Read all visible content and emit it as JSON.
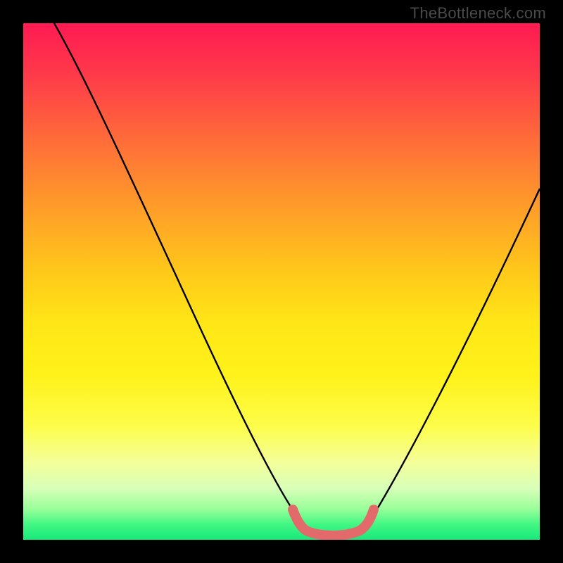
{
  "watermark": {
    "text": "TheBottleneck.com"
  },
  "chart_data": {
    "type": "line",
    "title": "",
    "xlabel": "",
    "ylabel": "",
    "xlim": [
      0,
      100
    ],
    "ylim": [
      0,
      100
    ],
    "grid": false,
    "legend": false,
    "series": [
      {
        "name": "bottleneck-curve",
        "x": [
          6,
          10,
          15,
          20,
          25,
          30,
          35,
          40,
          45,
          50,
          53,
          55,
          57,
          60,
          63,
          65,
          68,
          72,
          78,
          85,
          92,
          99
        ],
        "y": [
          100,
          92,
          82,
          72,
          62,
          52,
          42,
          32,
          22,
          12,
          6,
          3,
          1.5,
          1,
          1.5,
          3,
          7,
          15,
          28,
          42,
          55,
          68
        ]
      },
      {
        "name": "minimum-marker",
        "x": [
          53,
          55,
          57,
          59,
          61,
          63,
          65
        ],
        "y": [
          5,
          2.2,
          1.2,
          1,
          1.2,
          2.2,
          5
        ]
      }
    ],
    "gradient_stops": [
      {
        "pos": 0,
        "color": "#ff1a52"
      },
      {
        "pos": 10,
        "color": "#ff3a4a"
      },
      {
        "pos": 22,
        "color": "#ff6a3a"
      },
      {
        "pos": 35,
        "color": "#ff9a2a"
      },
      {
        "pos": 48,
        "color": "#ffc81a"
      },
      {
        "pos": 58,
        "color": "#ffe617"
      },
      {
        "pos": 68,
        "color": "#fff21a"
      },
      {
        "pos": 78,
        "color": "#fdfd4a"
      },
      {
        "pos": 85,
        "color": "#f4ff9a"
      },
      {
        "pos": 90,
        "color": "#d8ffb8"
      },
      {
        "pos": 94,
        "color": "#9aff9a"
      },
      {
        "pos": 97,
        "color": "#42f784"
      },
      {
        "pos": 100,
        "color": "#18e97a"
      }
    ],
    "colors": {
      "curve": "#000000",
      "marker": "#e26a6a",
      "frame": "#000000"
    }
  }
}
